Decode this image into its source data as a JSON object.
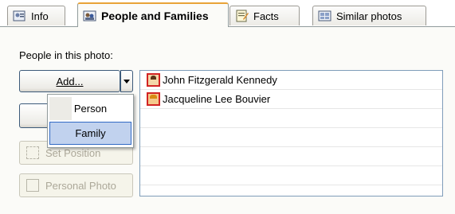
{
  "tabs": [
    {
      "label": "Info",
      "icon": "info-card-icon",
      "active": false
    },
    {
      "label": "People and Families",
      "icon": "people-icon",
      "active": true
    },
    {
      "label": "Facts",
      "icon": "facts-notepad-icon",
      "active": false
    },
    {
      "label": "Similar photos",
      "icon": "similar-photos-icon",
      "active": false
    }
  ],
  "panel": {
    "people_label": "People in this photo:",
    "add_button": "Add...",
    "set_position_button": "Set Position",
    "personal_photo_button": "Personal Photo",
    "people": [
      {
        "name": "John Fitzgerald Kennedy",
        "icon": "person-male-icon"
      },
      {
        "name": "Jacqueline Lee Bouvier",
        "icon": "person-female-icon"
      }
    ]
  },
  "add_menu": {
    "items": [
      "Person",
      "Family"
    ],
    "highlighted": "Family"
  },
  "colors": {
    "active_tab_accent": "#e8a337",
    "menu_highlight": "#c1d2ee",
    "avatar_border": "#d22323"
  }
}
